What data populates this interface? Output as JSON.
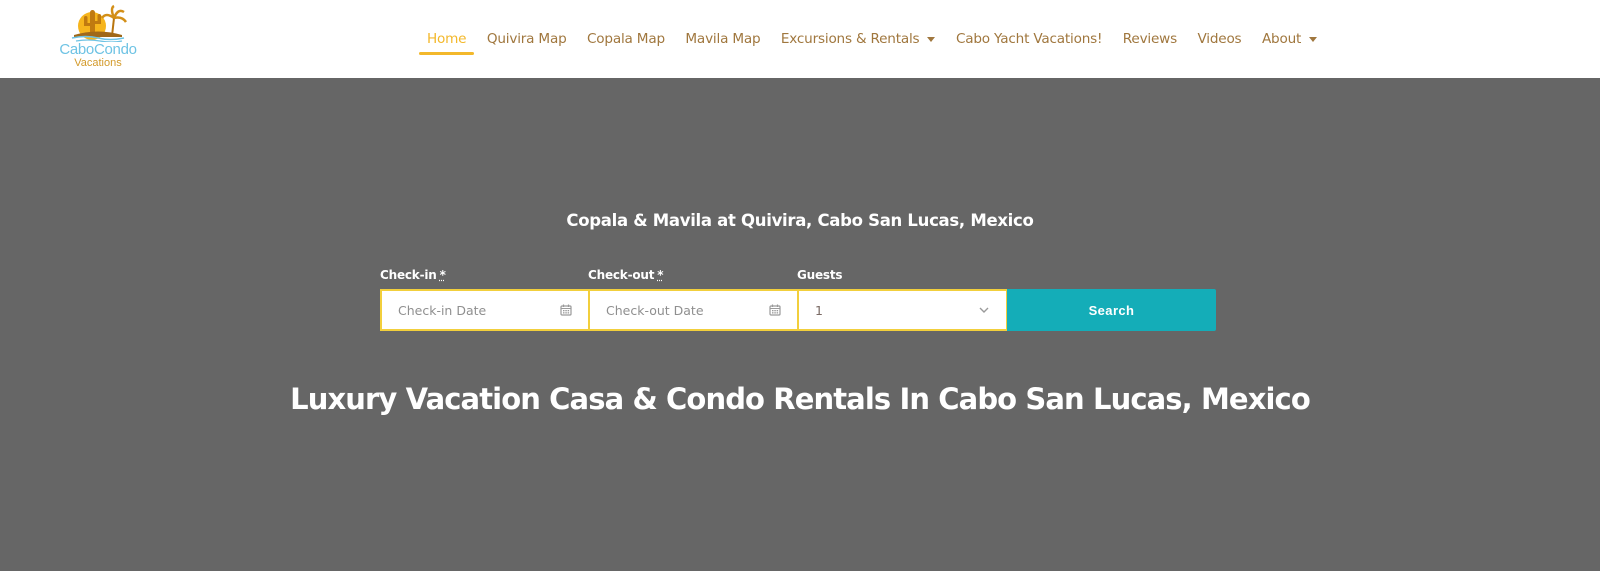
{
  "brand": {
    "logo_line1": "CaboCondo",
    "logo_line2": "Vacations"
  },
  "nav": {
    "items": [
      {
        "label": "Home",
        "active": true,
        "has_dropdown": false
      },
      {
        "label": "Quivira Map",
        "active": false,
        "has_dropdown": false
      },
      {
        "label": "Copala Map",
        "active": false,
        "has_dropdown": false
      },
      {
        "label": "Mavila Map",
        "active": false,
        "has_dropdown": false
      },
      {
        "label": "Excursions & Rentals",
        "active": false,
        "has_dropdown": true
      },
      {
        "label": "Cabo Yacht Vacations!",
        "active": false,
        "has_dropdown": false
      },
      {
        "label": "Reviews",
        "active": false,
        "has_dropdown": false
      },
      {
        "label": "Videos",
        "active": false,
        "has_dropdown": false
      },
      {
        "label": "About",
        "active": false,
        "has_dropdown": true
      }
    ]
  },
  "hero": {
    "subtitle": "Copala & Mavila at Quivira, Cabo San Lucas, Mexico",
    "headline": "Luxury Vacation Casa & Condo Rentals In Cabo San Lucas, Mexico"
  },
  "booking": {
    "checkin_label": "Check-in",
    "checkout_label": "Check-out",
    "guests_label": "Guests",
    "required_mark": "*",
    "checkin_placeholder": "Check-in Date",
    "checkout_placeholder": "Check-out Date",
    "guests_value": "1",
    "search_label": "Search"
  },
  "colors": {
    "nav_text": "#a0773e",
    "nav_active": "#f3b82b",
    "hero_bg": "#666666",
    "field_border": "#f2cf3c",
    "search_bg": "#14adb8"
  }
}
